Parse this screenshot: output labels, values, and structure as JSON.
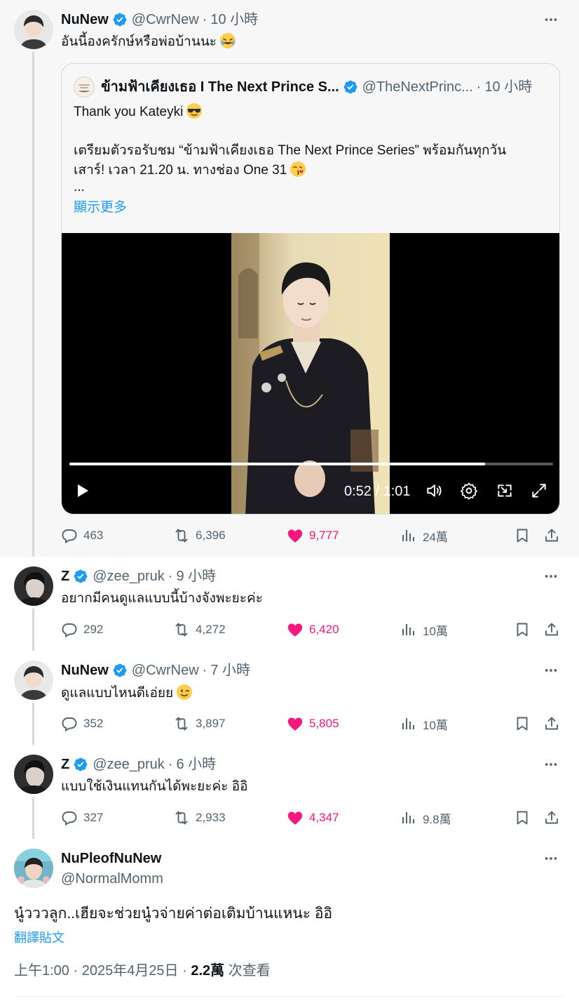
{
  "colors": {
    "accent": "#1d9bf0",
    "like": "#f91880",
    "muted": "#536471",
    "text": "#0f1419"
  },
  "main_post": {
    "name": "NuNew",
    "handle": "@CwrNew",
    "time": "10 小時",
    "text": "อันนี้องครักษ์หรือพ่อบ้านนะ",
    "quote": {
      "name": "ข้ามฟ้าเคียงเธอ I The Next Prince S...",
      "handle": "@TheNextPrinc...",
      "time": "10 小時",
      "line1": "Thank you Kateyki",
      "line2": "เตรียมตัวรอรับชม “ข้ามฟ้าเคียงเธอ The Next Prince Series” พร้อมกันทุกวัน",
      "line3": "เสาร์! เวลา 21.20 น. ทางช่อง One 31",
      "ellipsis": "...",
      "show_more": "顯示更多",
      "video_time": "0:52 / 1:01",
      "video_progress": 0.86
    },
    "stats": {
      "replies": "463",
      "reposts": "6,396",
      "likes": "9,777",
      "views": "24萬"
    }
  },
  "reply1": {
    "name": "Z",
    "handle": "@zee_pruk",
    "time": "9 小時",
    "text": "อยากมีคนดูแลแบบนี้บ้างจังพะยะค่ะ",
    "stats": {
      "replies": "292",
      "reposts": "4,272",
      "likes": "6,420",
      "views": "10萬"
    }
  },
  "reply2": {
    "name": "NuNew",
    "handle": "@CwrNew",
    "time": "7 小時",
    "text": "ดูแลแบบไหนดีเอ่ยย",
    "stats": {
      "replies": "352",
      "reposts": "3,897",
      "likes": "5,805",
      "views": "10萬"
    }
  },
  "reply3": {
    "name": "Z",
    "handle": "@zee_pruk",
    "time": "6 小時",
    "text": "แบบใช้เงินแทนกันได้พะยะค่ะ อิอิ",
    "stats": {
      "replies": "327",
      "reposts": "2,933",
      "likes": "4,347",
      "views": "9.8萬"
    }
  },
  "focused": {
    "name": "NuPleofNuNew",
    "handle": "@NormalMomm",
    "text": "นู๋วววลูก..เฮียจะช่วยนู๋วจ่ายค่าต่อเติมบ้านแหนะ อิอิ",
    "translate": "翻譯貼文",
    "timestamp": "上午1:00 · 2025年4月25日 · ",
    "views": "2.2萬",
    "views_suffix": " 次查看"
  },
  "icons": [
    "verified-icon",
    "more-icon",
    "reply-icon",
    "repost-icon",
    "like-icon",
    "views-icon",
    "bookmark-icon",
    "share-icon",
    "play-icon",
    "volume-icon",
    "settings-icon",
    "pip-icon",
    "fullscreen-icon"
  ]
}
